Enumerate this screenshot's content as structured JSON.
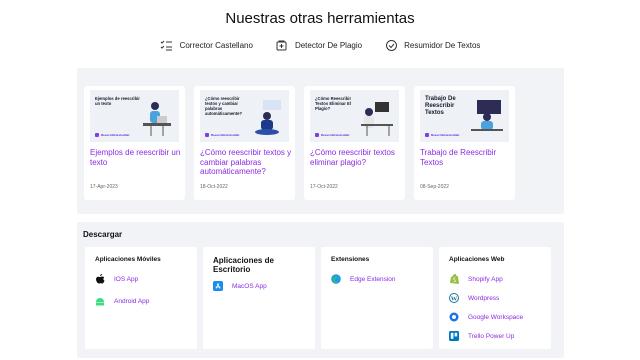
{
  "heading": "Nuestras otras herramientas",
  "tools": [
    {
      "label": "Corrector Castellano",
      "icon": "checklist-icon"
    },
    {
      "label": "Detector De Plagio",
      "icon": "shield-icon"
    },
    {
      "label": "Resumidor De Textos",
      "icon": "badge-check-icon"
    }
  ],
  "articles": [
    {
      "thumb_text": "Ejemplos de reescribir un texto",
      "title": "Ejemplos de reescribir un texto",
      "date": "17-Apr-2023"
    },
    {
      "thumb_text": "¿Cómo reescribir textos y cambiar palabras automáticamente?",
      "title": "¿Cómo reescribir textos y cambiar palabras automáticamente?",
      "date": "18-Oct-2022"
    },
    {
      "thumb_text": "¿Cómo Reescribir Textos Eliminar El Plagio?",
      "title": "¿Cómo reescribir textos eliminar plagio?",
      "date": "17-Oct-2022"
    },
    {
      "thumb_text": "Trabajo De Reescribir Textos",
      "title": "Trabajo de Reescribir Textos",
      "date": "08-Sep-2022"
    }
  ],
  "thumb_brand": "ReescribirtextosNet",
  "download": {
    "title": "Descargar",
    "mobile": {
      "title": "Aplicaciones Móviles",
      "items": [
        {
          "label": "IOS App",
          "icon": "apple-icon"
        },
        {
          "label": "Android App",
          "icon": "android-icon"
        }
      ]
    },
    "desktop": {
      "title": "Aplicaciones de Escritorio",
      "items": [
        {
          "label": "MacOS App",
          "icon": "app-store-icon"
        }
      ]
    },
    "extensions": {
      "title": "Extensiones",
      "items": [
        {
          "label": "Edge Extension",
          "icon": "edge-icon"
        }
      ]
    },
    "web": {
      "title": "Aplicaciones Web",
      "items": [
        {
          "label": "Shopify App",
          "icon": "shopify-icon"
        },
        {
          "label": "Wordpress",
          "icon": "wordpress-icon"
        },
        {
          "label": "Google Workspace",
          "icon": "google-workspace-icon"
        },
        {
          "label": "Trello Power Up",
          "icon": "trello-icon"
        }
      ]
    }
  },
  "colors": {
    "link": "#8a2be2",
    "panel": "#f1f3f7",
    "brand": "#7b3fe4"
  }
}
